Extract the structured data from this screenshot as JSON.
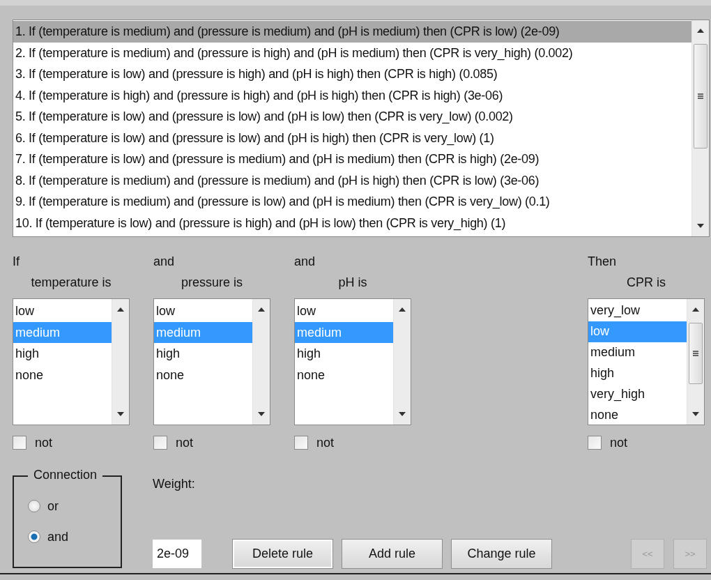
{
  "rules": {
    "items": [
      {
        "text": "1. If (temperature is medium) and (pressure is medium) and (pH is medium) then (CPR is low) (2e-09)",
        "selected": true
      },
      {
        "text": "2. If (temperature is medium) and (pressure is high) and (pH is medium) then (CPR is very_high) (0.002)",
        "selected": false
      },
      {
        "text": "3. If (temperature is low) and (pressure is high) and (pH is high) then (CPR is high) (0.085)",
        "selected": false
      },
      {
        "text": "4. If (temperature is high) and (pressure is high) and (pH is high) then (CPR is high) (3e-06)",
        "selected": false
      },
      {
        "text": "5. If (temperature is low) and (pressure is low) and (pH is low) then (CPR is very_low) (0.002)",
        "selected": false
      },
      {
        "text": "6. If (temperature is low) and (pressure is low) and (pH is high) then (CPR is very_low) (1)",
        "selected": false
      },
      {
        "text": "7. If (temperature is low) and (pressure is medium) and (pH is medium) then (CPR is high) (2e-09)",
        "selected": false
      },
      {
        "text": "8. If (temperature is medium) and (pressure is medium) and (pH is high) then (CPR is low) (3e-06)",
        "selected": false
      },
      {
        "text": "9. If (temperature is medium) and (pressure is low) and (pH is medium) then (CPR is very_low) (0.1)",
        "selected": false
      },
      {
        "text": "10. If (temperature is low) and (pressure is high) and (pH is low) then (CPR is very_high) (1)",
        "selected": false
      }
    ]
  },
  "antecedents": [
    {
      "connector": "If",
      "label": "temperature is",
      "options": [
        {
          "text": "low",
          "selected": false
        },
        {
          "text": "medium",
          "selected": true
        },
        {
          "text": "high",
          "selected": false
        },
        {
          "text": "none",
          "selected": false
        }
      ],
      "not": {
        "label": "not",
        "checked": false
      }
    },
    {
      "connector": "and",
      "label": "pressure is",
      "options": [
        {
          "text": "low",
          "selected": false
        },
        {
          "text": "medium",
          "selected": true
        },
        {
          "text": "high",
          "selected": false
        },
        {
          "text": "none",
          "selected": false
        }
      ],
      "not": {
        "label": "not",
        "checked": false
      }
    },
    {
      "connector": "and",
      "label": "pH is",
      "options": [
        {
          "text": "low",
          "selected": false
        },
        {
          "text": "medium",
          "selected": true
        },
        {
          "text": "high",
          "selected": false
        },
        {
          "text": "none",
          "selected": false
        }
      ],
      "not": {
        "label": "not",
        "checked": false
      }
    }
  ],
  "consequent": {
    "connector": "Then",
    "label": "CPR is",
    "options": [
      {
        "text": "very_low",
        "selected": false
      },
      {
        "text": "low",
        "selected": true
      },
      {
        "text": "medium",
        "selected": false
      },
      {
        "text": "high",
        "selected": false
      },
      {
        "text": "very_high",
        "selected": false
      },
      {
        "text": "none",
        "selected": false
      }
    ],
    "not": {
      "label": "not",
      "checked": false
    }
  },
  "connection": {
    "title": "Connection",
    "options": [
      {
        "label": "or",
        "selected": false
      },
      {
        "label": "and",
        "selected": true
      }
    ]
  },
  "weight": {
    "label": "Weight:",
    "value": "2e-09"
  },
  "buttons": [
    {
      "label": "Delete rule",
      "disabled": false
    },
    {
      "label": "Add rule",
      "disabled": false
    },
    {
      "label": "Change rule",
      "disabled": false
    }
  ],
  "nav_buttons": [
    {
      "label": "<<",
      "disabled": true
    },
    {
      "label": ">>",
      "disabled": true
    }
  ]
}
